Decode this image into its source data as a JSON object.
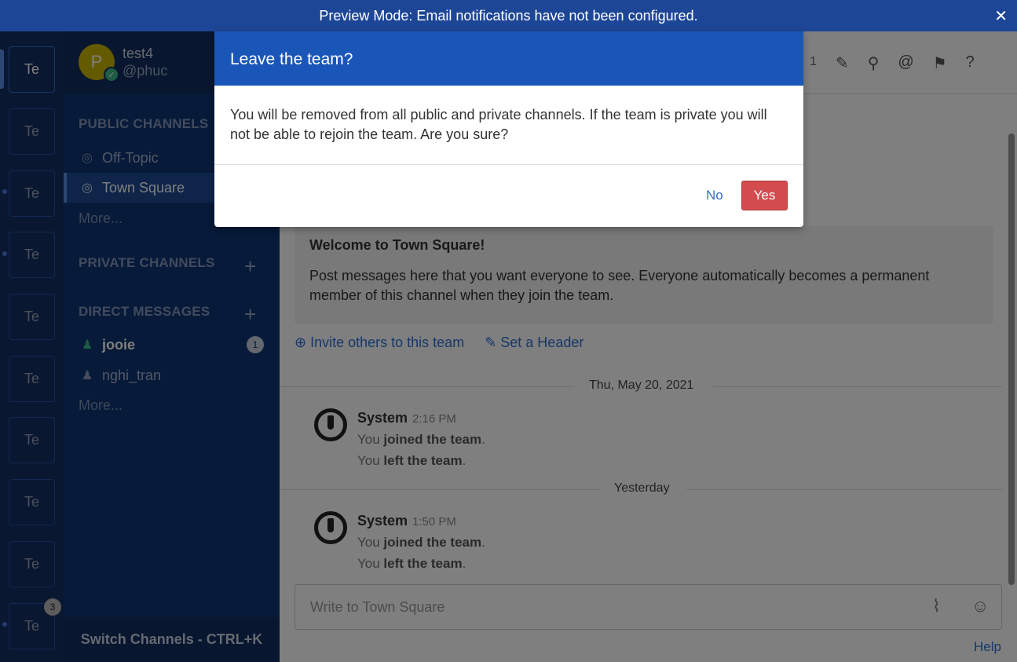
{
  "banner": {
    "text": "Preview Mode: Email notifications have not been configured.",
    "close": "✕"
  },
  "teams": {
    "label": "Te",
    "count": 10,
    "mention_badge": "3"
  },
  "user": {
    "initial": "P",
    "name": "test4",
    "handle": "@phuc",
    "status_icon": "✓"
  },
  "sidebar": {
    "public_title": "PUBLIC CHANNELS",
    "public_channels": [
      {
        "label": "Off-Topic",
        "icon": "globe-icon"
      },
      {
        "label": "Town Square",
        "icon": "globe-icon",
        "active": true
      }
    ],
    "public_more": "More...",
    "private_title": "PRIVATE CHANNELS",
    "dm_title": "DIRECT MESSAGES",
    "dms": [
      {
        "label": "jooie",
        "unread": "1"
      },
      {
        "label": "nghi_tran"
      }
    ],
    "dm_more": "More...",
    "add": "+",
    "switch": "Switch Channels - CTRL+K"
  },
  "header": {
    "member_count": "1"
  },
  "welcome": {
    "title": "Welcome to Town Square!",
    "description": "Post messages here that you want everyone to see. Everyone automatically becomes a permanent member of this channel when they join the team."
  },
  "intro_links": {
    "invite": "Invite others to this team",
    "header": "Set a Header"
  },
  "dates": [
    "Thu, May 20, 2021",
    "Yesterday"
  ],
  "posts": [
    {
      "name": "System",
      "time": "2:16 PM",
      "line1_pre": "You ",
      "line1_b": "joined the team",
      "line2_pre": "You ",
      "line2_b": "left the team"
    },
    {
      "name": "System",
      "time": "1:50 PM",
      "line1_pre": "You ",
      "line1_b": "joined the team",
      "line2_pre": "You ",
      "line2_b": "left the team"
    }
  ],
  "composer": {
    "placeholder": "Write to Town Square"
  },
  "help": "Help",
  "modal": {
    "title": "Leave the team?",
    "body": "You will be removed from all public and private channels. If the team is private you will not be able to rejoin the team. Are you sure?",
    "no": "No",
    "yes": "Yes"
  }
}
